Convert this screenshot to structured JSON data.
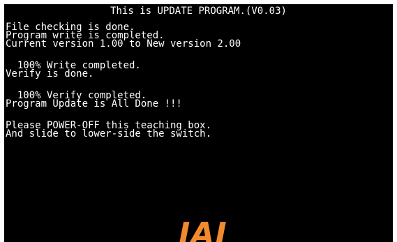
{
  "screen": {
    "title": "This is UPDATE PROGRAM.(V0.03)",
    "lines": [
      "File checking is done.",
      "Program write is completed.",
      "Current version 1.00 to New version 2.00",
      "  100% Write completed.",
      "Verify is done.",
      "  100% Verify completed.",
      "Program Update is All Done !!!",
      "Please POWER-OFF this teaching box.",
      "And slide to lower-side the switch."
    ],
    "logo_text": "IAI"
  },
  "colors": {
    "background": "#000000",
    "text": "#ffffff",
    "logo": "#f08a2c"
  }
}
